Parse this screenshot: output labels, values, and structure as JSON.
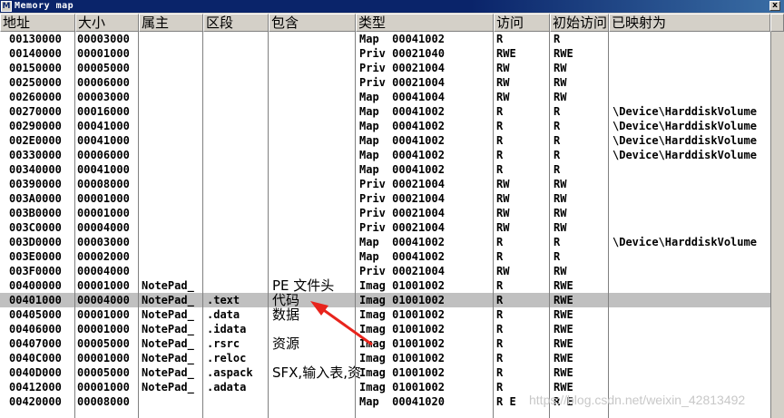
{
  "window": {
    "icon_letter": "M",
    "title": "Memory map",
    "close_glyph": "x"
  },
  "columns": {
    "addr": "地址",
    "size": "大小",
    "owner": "属主",
    "section": "区段",
    "contains": "包含",
    "type": "类型",
    "access": "访问",
    "initial": "初始访问",
    "mapped": "已映射为"
  },
  "rows": [
    {
      "addr": "00130000",
      "size": "00003000",
      "owner": "",
      "section": "",
      "contains": "",
      "type": "Map  00041002",
      "access": "R",
      "initial": "R",
      "mapped": ""
    },
    {
      "addr": "00140000",
      "size": "00001000",
      "owner": "",
      "section": "",
      "contains": "",
      "type": "Priv 00021040",
      "access": "RWE",
      "initial": "RWE",
      "mapped": ""
    },
    {
      "addr": "00150000",
      "size": "00005000",
      "owner": "",
      "section": "",
      "contains": "",
      "type": "Priv 00021004",
      "access": "RW",
      "initial": "RW",
      "mapped": ""
    },
    {
      "addr": "00250000",
      "size": "00006000",
      "owner": "",
      "section": "",
      "contains": "",
      "type": "Priv 00021004",
      "access": "RW",
      "initial": "RW",
      "mapped": ""
    },
    {
      "addr": "00260000",
      "size": "00003000",
      "owner": "",
      "section": "",
      "contains": "",
      "type": "Map  00041004",
      "access": "RW",
      "initial": "RW",
      "mapped": ""
    },
    {
      "addr": "00270000",
      "size": "00016000",
      "owner": "",
      "section": "",
      "contains": "",
      "type": "Map  00041002",
      "access": "R",
      "initial": "R",
      "mapped": "\\Device\\HarddiskVolume"
    },
    {
      "addr": "00290000",
      "size": "00041000",
      "owner": "",
      "section": "",
      "contains": "",
      "type": "Map  00041002",
      "access": "R",
      "initial": "R",
      "mapped": "\\Device\\HarddiskVolume"
    },
    {
      "addr": "002E0000",
      "size": "00041000",
      "owner": "",
      "section": "",
      "contains": "",
      "type": "Map  00041002",
      "access": "R",
      "initial": "R",
      "mapped": "\\Device\\HarddiskVolume"
    },
    {
      "addr": "00330000",
      "size": "00006000",
      "owner": "",
      "section": "",
      "contains": "",
      "type": "Map  00041002",
      "access": "R",
      "initial": "R",
      "mapped": "\\Device\\HarddiskVolume"
    },
    {
      "addr": "00340000",
      "size": "00041000",
      "owner": "",
      "section": "",
      "contains": "",
      "type": "Map  00041002",
      "access": "R",
      "initial": "R",
      "mapped": ""
    },
    {
      "addr": "00390000",
      "size": "00008000",
      "owner": "",
      "section": "",
      "contains": "",
      "type": "Priv 00021004",
      "access": "RW",
      "initial": "RW",
      "mapped": ""
    },
    {
      "addr": "003A0000",
      "size": "00001000",
      "owner": "",
      "section": "",
      "contains": "",
      "type": "Priv 00021004",
      "access": "RW",
      "initial": "RW",
      "mapped": ""
    },
    {
      "addr": "003B0000",
      "size": "00001000",
      "owner": "",
      "section": "",
      "contains": "",
      "type": "Priv 00021004",
      "access": "RW",
      "initial": "RW",
      "mapped": ""
    },
    {
      "addr": "003C0000",
      "size": "00004000",
      "owner": "",
      "section": "",
      "contains": "",
      "type": "Priv 00021004",
      "access": "RW",
      "initial": "RW",
      "mapped": ""
    },
    {
      "addr": "003D0000",
      "size": "00003000",
      "owner": "",
      "section": "",
      "contains": "",
      "type": "Map  00041002",
      "access": "R",
      "initial": "R",
      "mapped": "\\Device\\HarddiskVolume"
    },
    {
      "addr": "003E0000",
      "size": "00002000",
      "owner": "",
      "section": "",
      "contains": "",
      "type": "Map  00041002",
      "access": "R",
      "initial": "R",
      "mapped": ""
    },
    {
      "addr": "003F0000",
      "size": "00004000",
      "owner": "",
      "section": "",
      "contains": "",
      "type": "Priv 00021004",
      "access": "RW",
      "initial": "RW",
      "mapped": ""
    },
    {
      "addr": "00400000",
      "size": "00001000",
      "owner": "NotePad_",
      "section": "",
      "contains": "PE 文件头",
      "type": "Imag 01001002",
      "access": "R",
      "initial": "RWE",
      "mapped": ""
    },
    {
      "addr": "00401000",
      "size": "00004000",
      "owner": "NotePad_",
      "section": ".text",
      "contains": "代码",
      "type": "Imag 01001002",
      "access": "R",
      "initial": "RWE",
      "mapped": "",
      "selected": true
    },
    {
      "addr": "00405000",
      "size": "00001000",
      "owner": "NotePad_",
      "section": ".data",
      "contains": "数据",
      "type": "Imag 01001002",
      "access": "R",
      "initial": "RWE",
      "mapped": ""
    },
    {
      "addr": "00406000",
      "size": "00001000",
      "owner": "NotePad_",
      "section": ".idata",
      "contains": "",
      "type": "Imag 01001002",
      "access": "R",
      "initial": "RWE",
      "mapped": ""
    },
    {
      "addr": "00407000",
      "size": "00005000",
      "owner": "NotePad_",
      "section": ".rsrc",
      "contains": "资源",
      "type": "Imag 01001002",
      "access": "R",
      "initial": "RWE",
      "mapped": ""
    },
    {
      "addr": "0040C000",
      "size": "00001000",
      "owner": "NotePad_",
      "section": ".reloc",
      "contains": "",
      "type": "Imag 01001002",
      "access": "R",
      "initial": "RWE",
      "mapped": ""
    },
    {
      "addr": "0040D000",
      "size": "00005000",
      "owner": "NotePad_",
      "section": ".aspack",
      "contains": "SFX,输入表,资",
      "type": "Imag 01001002",
      "access": "R",
      "initial": "RWE",
      "mapped": ""
    },
    {
      "addr": "00412000",
      "size": "00001000",
      "owner": "NotePad_",
      "section": ".adata",
      "contains": "",
      "type": "Imag 01001002",
      "access": "R",
      "initial": "RWE",
      "mapped": ""
    },
    {
      "addr": "00420000",
      "size": "00008000",
      "owner": "",
      "section": "",
      "contains": "",
      "type": "Map  00041020",
      "access": "R E",
      "initial": "R E",
      "mapped": ""
    }
  ],
  "watermark": "https://blog.csdn.net/weixin_42813492",
  "colors": {
    "title_bar": "#0a246a",
    "selection": "#c0c0c0",
    "annotation_arrow": "#e8241c"
  }
}
